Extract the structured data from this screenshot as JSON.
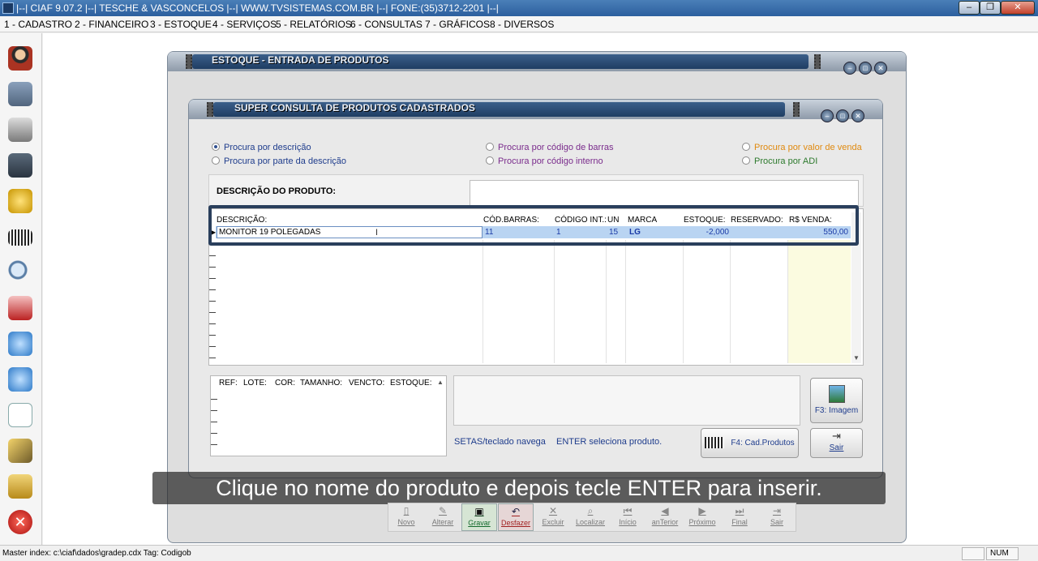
{
  "app": {
    "title": "|--| CIAF 9.07.2 |--| TESCHE & VASCONCELOS |--| WWW.TVSISTEMAS.COM.BR |--| FONE:(35)3712-2201 |--|",
    "min": "‒",
    "restore": "❐",
    "close": "✕"
  },
  "menu": [
    "1 - CADASTRO",
    "2 - FINANCEIRO",
    "3 - ESTOQUE",
    "4 - SERVIÇOS",
    "5 - RELATÓRIOS",
    "6 - CONSULTAS",
    "7 - GRÁFICOS",
    "8 - DIVERSOS"
  ],
  "left_toolbar_icons": [
    "user-icon",
    "bank-icon",
    "cash-register-icon",
    "door-icon",
    "coins-icon",
    "barcode-icon",
    "magnifier-icon",
    "cart-icon",
    "internet-icon",
    "internet-icon",
    "document-icon",
    "tools-icon",
    "safe-icon",
    "exit-icon"
  ],
  "outer_window": {
    "title": "ESTOQUE - ENTRADA DE PRODUTOS"
  },
  "inner_window": {
    "title": "SUPER CONSULTA DE PRODUTOS CADASTRADOS",
    "search_options": {
      "por_descricao": "Procura por descrição",
      "por_parte": "Procura por parte da descrição",
      "por_barras": "Procura por código de barras",
      "por_interno": "Procura por código interno",
      "por_valor": "Procura por valor de venda",
      "por_adi": "Procura por ADI"
    },
    "description_label": "DESCRIÇÃO DO PRODUTO:",
    "description_value": "",
    "grid": {
      "columns": [
        "DESCRIÇÃO:",
        "CÓD.BARRAS:",
        "CÓDIGO INT.:",
        "UN",
        "MARCA",
        "ESTOQUE:",
        "RESERVADO:",
        "R$ VENDA:"
      ],
      "rows": [
        {
          "descricao": "MONITOR 19 POLEGADAS",
          "cod_barras": "11",
          "codigo_int": "1",
          "un": "15",
          "marca": "LG",
          "estoque": "-2,000",
          "reservado": "",
          "venda": "550,00"
        }
      ]
    },
    "subgrid": {
      "columns": [
        "REF:",
        "LOTE:",
        "COR:",
        "TAMANHO:",
        "VENCTO:",
        "ESTOQUE:"
      ]
    },
    "hint_nav": "SETAS/teclado navega",
    "hint_enter": "ENTER seleciona produto.",
    "btn_imagem": "F3: Imagem",
    "btn_cad": "F4: Cad.Produtos",
    "btn_sair": "Sair"
  },
  "subtitle": "Clique no nome do produto e depois tecle ENTER para inserir.",
  "crud_toolbar": [
    {
      "label": "Novo",
      "glyph": "▯"
    },
    {
      "label": "Alterar",
      "glyph": "✎"
    },
    {
      "label": "Gravar",
      "glyph": "▣"
    },
    {
      "label": "Desfazer",
      "glyph": "↶"
    },
    {
      "label": "Excluir",
      "glyph": "✕"
    },
    {
      "label": "Localizar",
      "glyph": "⌕"
    },
    {
      "label": "Início",
      "glyph": "⏮"
    },
    {
      "label": "anTerior",
      "glyph": "◀"
    },
    {
      "label": "Próximo",
      "glyph": "▶"
    },
    {
      "label": "Final",
      "glyph": "⏭"
    },
    {
      "label": "Sair",
      "glyph": "⇥"
    }
  ],
  "status": {
    "text": "Master index: c:\\ciaf\\dados\\gradep.cdx  Tag: Codigob",
    "num": "NUM"
  }
}
